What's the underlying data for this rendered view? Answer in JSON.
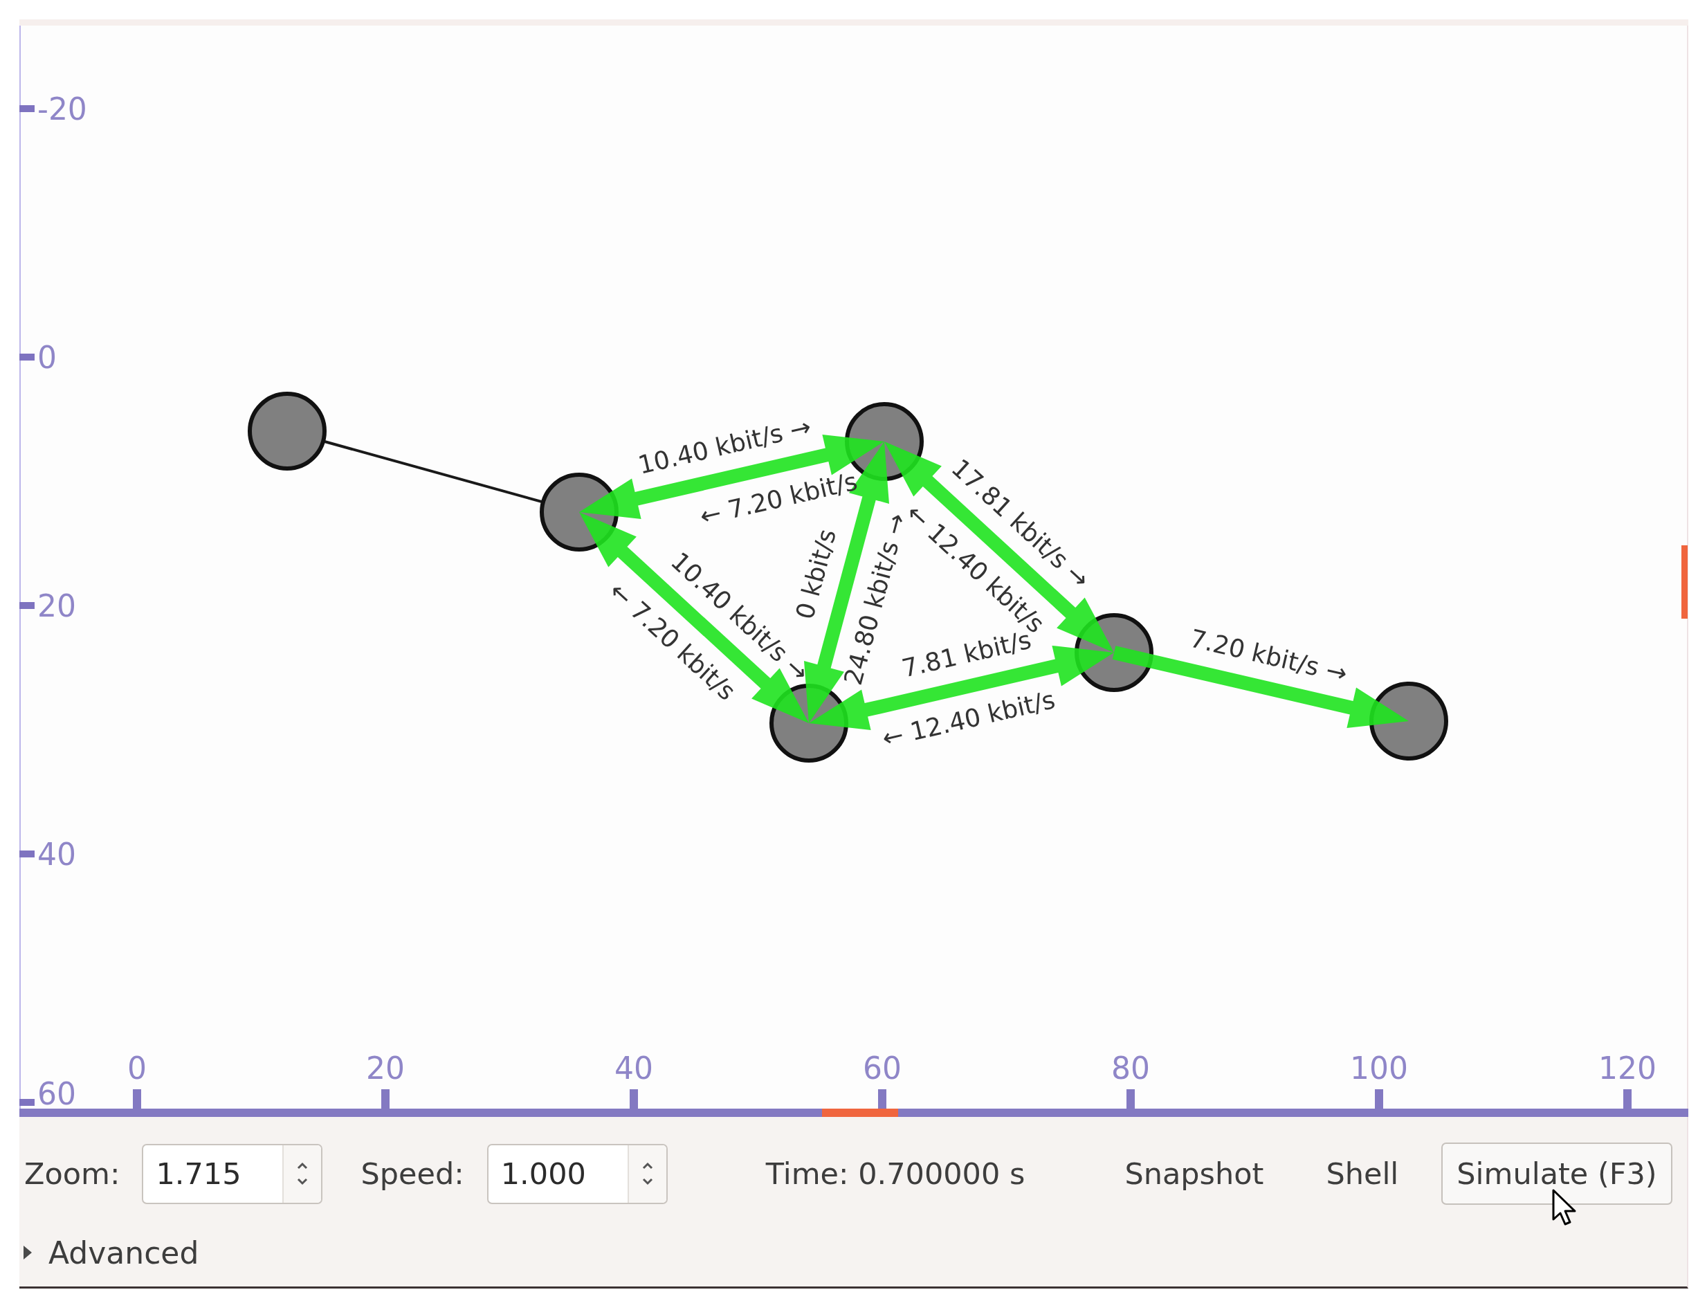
{
  "canvas": {
    "y_axis": {
      "ticks": [
        "-20",
        "0",
        "20",
        "40",
        "60"
      ]
    },
    "x_axis": {
      "ticks": [
        "0",
        "20",
        "40",
        "60",
        "80",
        "100",
        "120"
      ]
    },
    "links": [
      {
        "kind": "plain"
      },
      {
        "kind": "traffic",
        "labels": [
          "10.40 kbit/s →",
          "← 7.20 kbit/s"
        ]
      },
      {
        "kind": "traffic",
        "labels": [
          "10.40 kbit/s →",
          "← 7.20 kbit/s"
        ]
      },
      {
        "kind": "traffic",
        "labels": [
          "0 kbit/s",
          "24.80 kbit/s →"
        ]
      },
      {
        "kind": "traffic",
        "labels": [
          "17.81 kbit/s →",
          "← 12.40 kbit/s"
        ]
      },
      {
        "kind": "traffic",
        "labels": [
          "7.81 kbit/s",
          "← 12.40 kbit/s"
        ]
      },
      {
        "kind": "traffic",
        "labels": [
          "7.20 kbit/s →"
        ]
      }
    ]
  },
  "controls": {
    "zoom": {
      "label": "Zoom:",
      "value": "1.715"
    },
    "speed": {
      "label": "Speed:",
      "value": "1.000"
    },
    "time": "Time: 0.700000 s",
    "buttons": [
      {
        "label": "Snapshot",
        "kind": "flat"
      },
      {
        "label": "Shell",
        "kind": "flat"
      },
      {
        "label": "Simulate (F3)",
        "kind": "raised"
      }
    ]
  },
  "advanced": {
    "label": "Advanced",
    "expanded": false
  }
}
